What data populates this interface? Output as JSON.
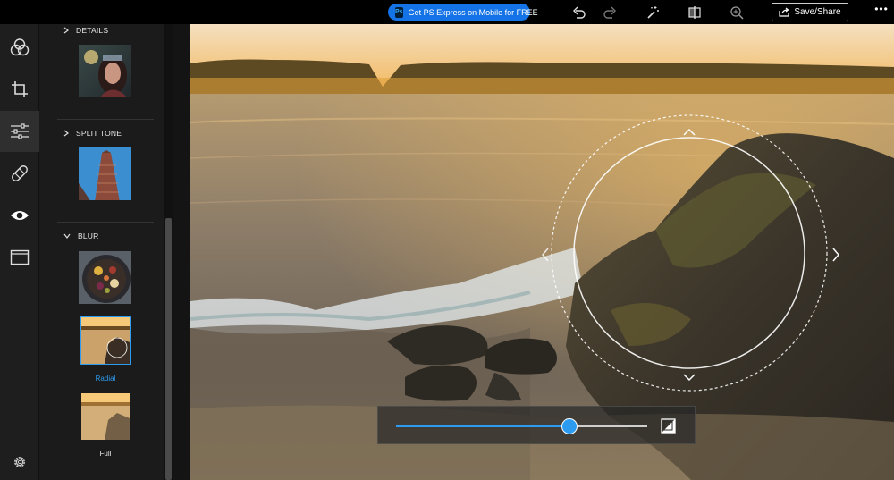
{
  "topbar": {
    "promo_label": "Get PS Express on Mobile for FREE",
    "promo_badge": "Ps",
    "save_label": "Save/Share",
    "more_label": "•••"
  },
  "rail": {
    "items": [
      {
        "name": "looks",
        "icon": "overlapping-circles-icon"
      },
      {
        "name": "crop",
        "icon": "crop-icon"
      },
      {
        "name": "adjustments",
        "icon": "sliders-icon",
        "active": true
      },
      {
        "name": "healing",
        "icon": "bandage-icon"
      },
      {
        "name": "red-eye",
        "icon": "eye-icon"
      },
      {
        "name": "borders",
        "icon": "frame-icon"
      },
      {
        "name": "settings",
        "icon": "gear-icon"
      }
    ]
  },
  "panel": {
    "sections": [
      {
        "label": "DETAILS",
        "expanded": false
      },
      {
        "label": "SPLIT TONE",
        "expanded": false
      },
      {
        "label": "BLUR",
        "expanded": true
      }
    ],
    "blur_options": [
      {
        "label": "Radial",
        "selected": true
      },
      {
        "label": "Full",
        "selected": false
      }
    ]
  },
  "slider": {
    "value_fraction": 0.69
  },
  "colors": {
    "accent": "#2d9bf0",
    "promo": "#1473e6",
    "background": "#1b1b1b"
  }
}
